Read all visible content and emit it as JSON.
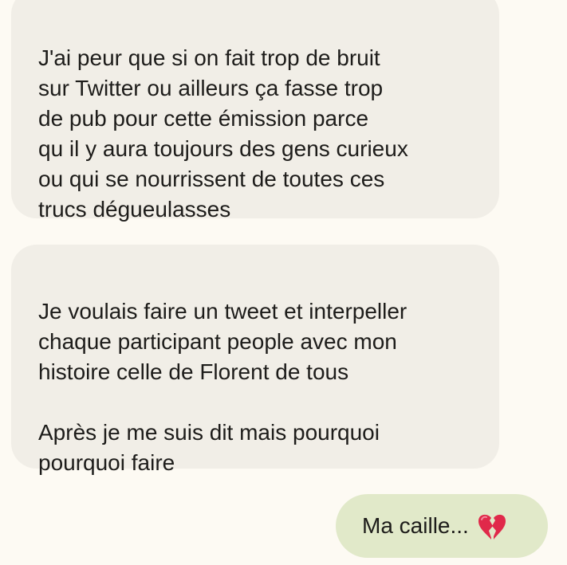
{
  "conversation": {
    "messages": [
      {
        "direction": "incoming",
        "text": "J'ai peur que si on fait trop de bruit\nsur Twitter ou ailleurs ça fasse trop\nde  pub pour cette émission parce\nqu il y aura toujours des gens curieux\nou qui se nourrissent de toutes ces\ntrucs dégueulasses"
      },
      {
        "direction": "incoming",
        "text": "Je voulais faire un tweet et interpeller\nchaque participant people avec mon\nhistoire celle de Florent de tous\n\nAprès je me suis dit mais pourquoi\npourquoi faire"
      },
      {
        "direction": "outgoing",
        "text": "Ma caille...",
        "emoji": "broken-heart-icon"
      }
    ]
  },
  "colors": {
    "background": "#fdfaf3",
    "incoming_bubble": "#f1eee7",
    "outgoing_bubble": "#e1e9c9",
    "text": "#1d1c1a",
    "heart": "#e0294a"
  }
}
